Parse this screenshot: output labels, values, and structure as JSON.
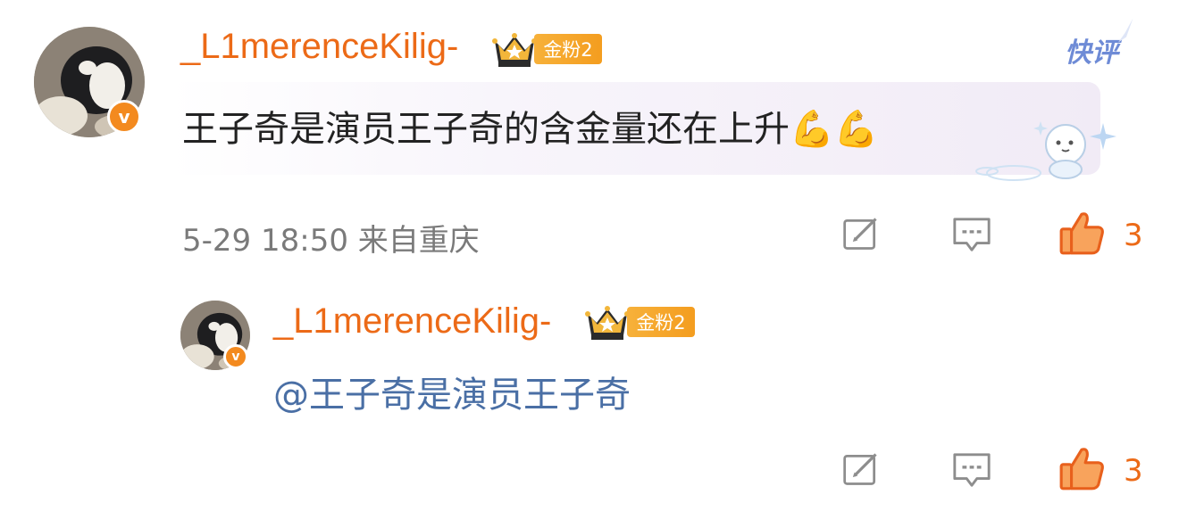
{
  "comments": [
    {
      "username": "_L1merenceKilig-",
      "fan_badge": "金粉2",
      "text": "王子奇是演员王子奇的含金量还在上升💪💪",
      "meta": "5-29 18:50 来自重庆",
      "likes": "3",
      "tag": "快评"
    },
    {
      "username": "_L1merenceKilig-",
      "fan_badge": "金粉2",
      "text": "@王子奇是演员王子奇",
      "likes": "3"
    }
  ],
  "colors": {
    "username": "#ec6a17",
    "mention": "#4a6fa5",
    "like": "#ec6a17",
    "meta": "#7a7a7a"
  },
  "icons": [
    "crown-icon",
    "verified-v-icon",
    "repost-icon",
    "comment-icon",
    "like-icon",
    "muscle-emoji",
    "sticker-decoration"
  ]
}
